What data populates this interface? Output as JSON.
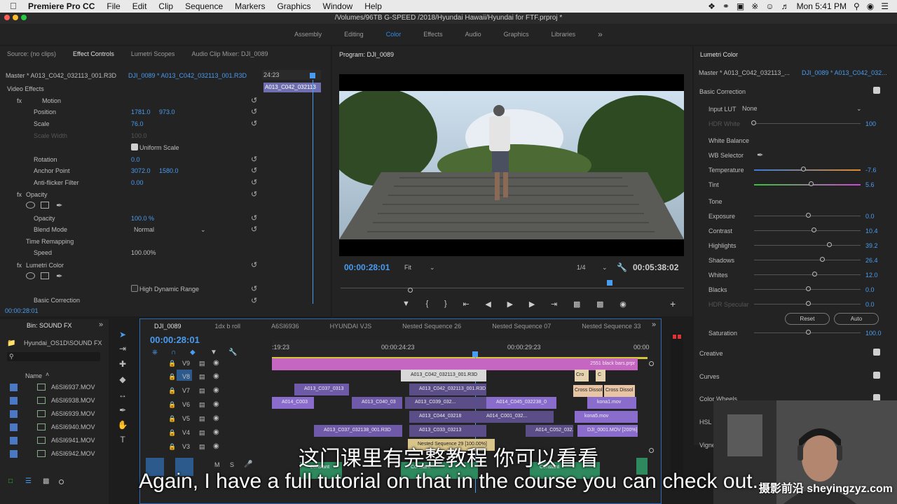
{
  "menubar": {
    "app": "Premiere Pro CC",
    "items": [
      "File",
      "Edit",
      "Clip",
      "Sequence",
      "Markers",
      "Graphics",
      "Window",
      "Help"
    ],
    "clock": "Mon 5:41 PM"
  },
  "titlebar": {
    "path": "/Volumes/96TB G-SPEED /2018/Hyundai Hawaii/Hyundai for FTF.prproj *"
  },
  "workspaces": [
    "Assembly",
    "Editing",
    "Color",
    "Effects",
    "Audio",
    "Graphics",
    "Libraries"
  ],
  "workspace_active": "Color",
  "workspace_more": "»",
  "source_panel": {
    "tabs": [
      "Source: (no clips)",
      "Effect Controls",
      "Lumetri Scopes",
      "Audio Clip Mixer: DJI_0089"
    ],
    "master": "Master * A013_C042_032113_001.R3D",
    "clip_link": "DJI_0089 * A013_C042_032113_001.R3D",
    "timecode_small": "24:23",
    "mini_clip": "A013_C042_032113",
    "section": "Video Effects",
    "motion": "Motion",
    "position_label": "Position",
    "position_x": "1781.0",
    "position_y": "973.0",
    "scale_label": "Scale",
    "scale_val": "76.0",
    "scale_width_label": "Scale Width",
    "scale_width_val": "100.0",
    "uniform_scale": "Uniform Scale",
    "rotation_label": "Rotation",
    "rotation_val": "0.0",
    "anchor_label": "Anchor Point",
    "anchor_x": "3072.0",
    "anchor_y": "1580.0",
    "antiflicker_label": "Anti-flicker Filter",
    "antiflicker_val": "0.00",
    "opacity_section": "Opacity",
    "opacity_label": "Opacity",
    "opacity_val": "100.0 %",
    "blend_label": "Blend Mode",
    "blend_val": "Normal",
    "time_remap": "Time Remapping",
    "speed_label": "Speed",
    "speed_val": "100.00%",
    "lumetri_section": "Lumetri Color",
    "hdr": "High Dynamic Range",
    "basic_correction": "Basic Correction",
    "timecode": "00:00:28:01"
  },
  "program": {
    "title": "Program: DJI_0089",
    "timecode": "00:00:28:01",
    "fit": "Fit",
    "resolution": "1/4",
    "duration": "00:05:38:02"
  },
  "lumetri": {
    "title": "Lumetri Color",
    "master": "Master * A013_C042_032113_...",
    "clip": "DJI_0089 * A013_C042_032...",
    "basic_correction": "Basic Correction",
    "input_lut_label": "Input LUT",
    "input_lut_val": "None",
    "hdr_white_label": "HDR White",
    "hdr_white_val": "100",
    "white_balance": "White Balance",
    "wb_selector": "WB Selector",
    "temperature_label": "Temperature",
    "temperature_val": "-7.6",
    "tint_label": "Tint",
    "tint_val": "5.6",
    "tone": "Tone",
    "exposure_label": "Exposure",
    "exposure_val": "0.0",
    "contrast_label": "Contrast",
    "contrast_val": "10.4",
    "highlights_label": "Highlights",
    "highlights_val": "39.2",
    "shadows_label": "Shadows",
    "shadows_val": "26.4",
    "whites_label": "Whites",
    "whites_val": "12.0",
    "blacks_label": "Blacks",
    "blacks_val": "0.0",
    "hdr_specular_label": "HDR Specular",
    "hdr_specular_val": "0.0",
    "reset": "Reset",
    "auto": "Auto",
    "saturation_label": "Saturation",
    "saturation_val": "100.0",
    "creative": "Creative",
    "curves": "Curves",
    "color_wheels": "Color Wheels",
    "hsl": "HSL",
    "vignette": "Vigne"
  },
  "bin": {
    "title": "Bin: SOUND FX",
    "path": "Hyundai_OS1D\\SOUND FX",
    "name_header": "Name",
    "items": [
      "A6SI6937.MOV",
      "A6SI6938.MOV",
      "A6SI6939.MOV",
      "A6SI6940.MOV",
      "A6SI6941.MOV",
      "A6SI6942.MOV"
    ]
  },
  "timeline": {
    "tabs": [
      "DJI_0089",
      "1dx b roll",
      "A6SI6936",
      "HYUNDAI VJS",
      "Nested Sequence 26",
      "Nested Sequence 07",
      "Nested Sequence 33"
    ],
    "timecode": "00:00:28:01",
    "ruler": [
      ":19:23",
      "00:00:24:23",
      "00:00:29:23",
      "00:00"
    ],
    "tracks": [
      "V9",
      "V8",
      "V7",
      "V6",
      "V5",
      "V4",
      "V3"
    ],
    "audio_labels": [
      "M",
      "S"
    ],
    "clips": {
      "v9": "2551 black bars.prpr",
      "v8a": "A013_C042_032113_001.R3D",
      "v8b": "Cro",
      "v8c": "C",
      "v7a": "A013_C037_0313",
      "v7b": "A013_C042_032113_001.R3D",
      "v7c": "Cross Dissol",
      "v7d": "Cross Dissol",
      "v6a": "A014_C003",
      "v6b": "A013_C040_03",
      "v6c": "A013_C039_032...",
      "v6d": "A014_C045_032238_0",
      "v6e": "kona1.mov",
      "v5a": "A013_C044_03218",
      "v5b": "A014_C001_032...",
      "v5c": "kona5.mov",
      "v4a": "A013_C037_032138_001.R3D",
      "v4b": "A013_C033_03213",
      "v4c": "A014_C052_032...",
      "v4d": "DJI_0001.MOV [200%]",
      "v3a": "Nested Sequence 29 [100.00%]",
      "a1": "Constant",
      "a2": "Constant",
      "a3": "Constant"
    }
  },
  "subtitle_cn": "这门课里有完整教程 你可以看看",
  "subtitle_en": "Again, I have a full tutorial on that in the course you can check out.",
  "watermark": "摄影前沿 sheyingzyz.com",
  "colors": {
    "accent": "#2d8ceb",
    "clip_pink": "#c466c2",
    "clip_purple": "#6e5aa8",
    "audio_green": "#2e8a5e"
  }
}
